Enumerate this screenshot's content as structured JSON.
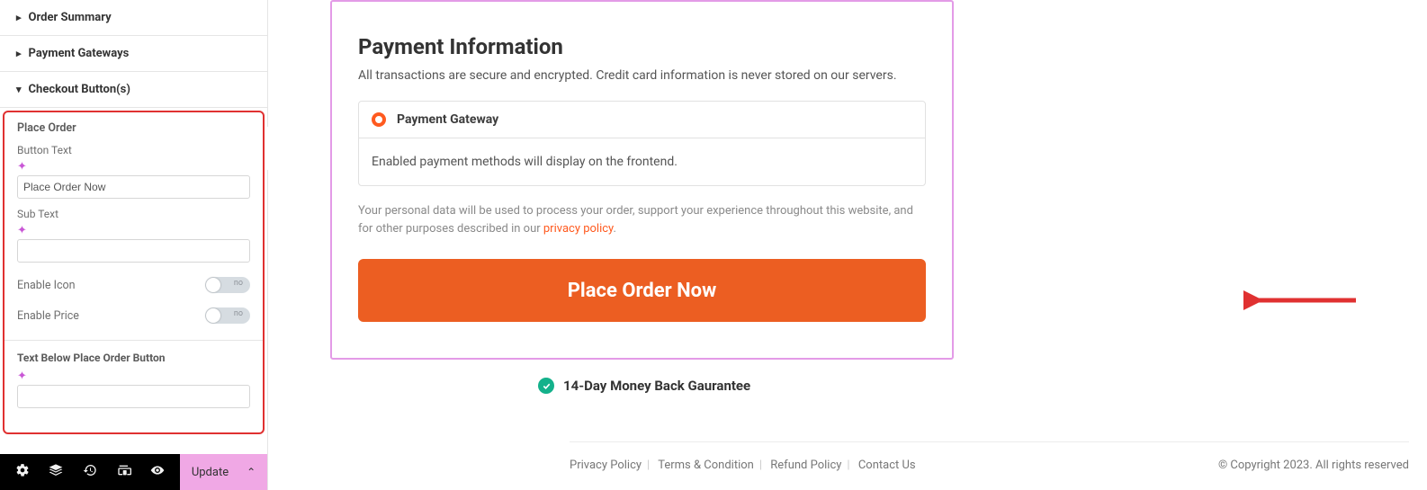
{
  "sidebar": {
    "accordion": {
      "order_summary": "Order Summary",
      "payment_gateways": "Payment Gateways",
      "checkout_buttons": "Checkout Button(s)"
    },
    "place_order": {
      "section_title": "Place Order",
      "button_text_label": "Button Text",
      "button_text_value": "Place Order Now",
      "sub_text_label": "Sub Text",
      "sub_text_value": "",
      "enable_icon_label": "Enable Icon",
      "enable_icon_state": "no",
      "enable_price_label": "Enable Price",
      "enable_price_state": "no",
      "text_below_title": "Text Below Place Order Button",
      "text_below_value": ""
    },
    "bottom": {
      "update_label": "Update"
    }
  },
  "preview": {
    "card": {
      "title": "Payment Information",
      "description": "All transactions are secure and encrypted. Credit card information is never stored on our servers.",
      "gateway_label": "Payment Gateway",
      "gateway_body": "Enabled payment methods will display on the frontend.",
      "privacy_prefix": "Your personal data will be used to process your order, support your experience throughout this website, and for other purposes described in our ",
      "privacy_link": "privacy policy",
      "privacy_suffix": ".",
      "button_label": "Place Order Now"
    },
    "guarantee": "14-Day Money Back Gaurantee"
  },
  "footer": {
    "links": {
      "privacy": "Privacy Policy",
      "terms": "Terms & Condition",
      "refund": "Refund Policy",
      "contact": "Contact Us"
    },
    "copyright": "© Copyright 2023. All rights reserved"
  }
}
